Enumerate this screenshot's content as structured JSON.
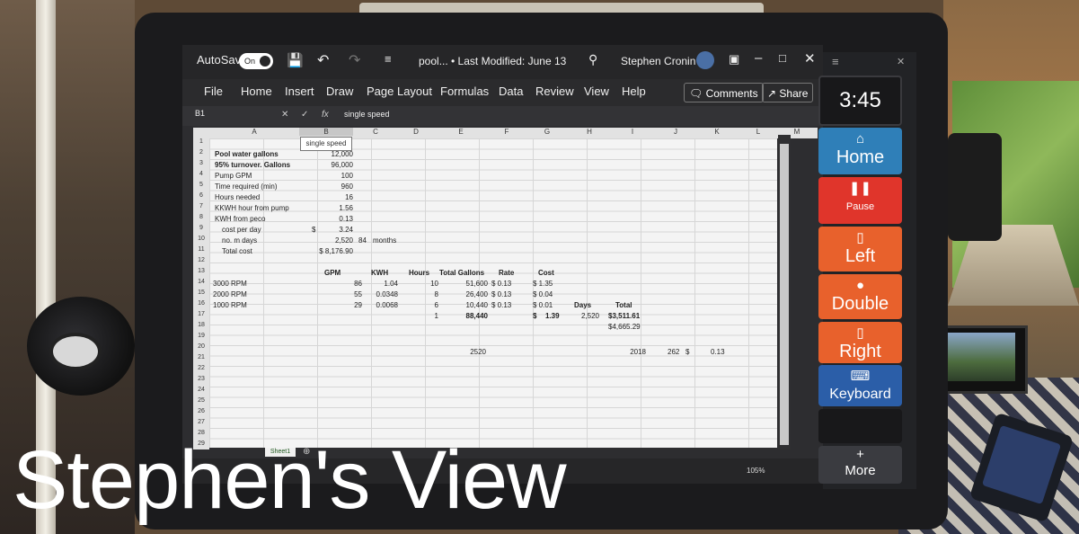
{
  "caption": "Stephen's View",
  "excel": {
    "autosave_label": "AutoSave",
    "autosave_state": "On",
    "filename": "pool... • Last Modified: June 13",
    "user": "Stephen Cronin",
    "menu": [
      "File",
      "Home",
      "Insert",
      "Draw",
      "Page Layout",
      "Formulas",
      "Data",
      "Review",
      "View",
      "Help"
    ],
    "comments_label": "Comments",
    "share_label": "Share",
    "namebox": "B1",
    "formula": "single speed",
    "columns": [
      "A",
      "B",
      "C",
      "D",
      "E",
      "F",
      "G",
      "H",
      "I",
      "J",
      "K",
      "L",
      "M"
    ],
    "rows": [
      "1",
      "2",
      "3",
      "4",
      "5",
      "6",
      "7",
      "8",
      "9",
      "10",
      "11",
      "12",
      "13",
      "14",
      "15",
      "16",
      "17",
      "18",
      "19",
      "20",
      "21",
      "22",
      "23",
      "24",
      "25",
      "26",
      "27",
      "28",
      "29"
    ],
    "tooltip": "single speed",
    "labels": {
      "r2": "Pool water gallons",
      "r3": "95% turnover. Gallons",
      "r4": "Pump GPM",
      "r5": "Time required (min)",
      "r6": "Hours needed",
      "r7": "KKWH hour from pump",
      "r8": "KWH from peco",
      "r9": "cost per day",
      "r10": "no. m days",
      "r11": "Total cost"
    },
    "values": {
      "r2": "12,000",
      "r3": "96,000",
      "r4": "100",
      "r5": "960",
      "r6": "16",
      "r7": "1.56",
      "r8": "0.13",
      "r9_sym": "$",
      "r9": "3.24",
      "r10": "2,520",
      "r10_c": "84",
      "r10_d": "months",
      "r11": "$ 8,176.90"
    },
    "table_headers": [
      "GPM",
      "KWH",
      "Hours",
      "Total Gallons",
      "Rate",
      "Cost"
    ],
    "table_rows": [
      {
        "label": "3000 RPM",
        "gpm": "86",
        "kwh": "1.04",
        "hours": "10",
        "gallons": "51,600",
        "rate": "$ 0.13",
        "cost": "$ 1.35"
      },
      {
        "label": "2000 RPM",
        "gpm": "55",
        "kwh": "0.0348",
        "hours": "8",
        "gallons": "26,400",
        "rate": "$ 0.13",
        "cost": "$ 0.04"
      },
      {
        "label": "1000 RPM",
        "gpm": "29",
        "kwh": "0.0068",
        "hours": "6",
        "gallons": "10,440",
        "rate": "$ 0.13",
        "cost": "$ 0.01"
      }
    ],
    "summary": {
      "hours_total": "1",
      "gallons_total": "88,440",
      "cost_sym": "$",
      "cost_total": "1.39",
      "days_label": "Days",
      "total_label": "Total",
      "days": "2,520",
      "total": "$3,511.61",
      "total2": "$4,665.29",
      "e21": "2520",
      "i21": "2018",
      "j21": "262",
      "k21_sym": "$",
      "k21": "0.13"
    },
    "sheet_tab": "Sheet1",
    "zoom": "105%"
  },
  "panel": {
    "time": "3:45 PM",
    "tiles": [
      {
        "label": "Home",
        "color": "#2f7fb8"
      },
      {
        "label": "Pause",
        "color": "#e0352b"
      },
      {
        "label": "Left",
        "color": "#e8612c"
      },
      {
        "label": "Double",
        "color": "#e8612c"
      },
      {
        "label": "Right",
        "color": "#e8612c"
      },
      {
        "label": "Keyboard",
        "color": "#2b5ea8"
      },
      {
        "label": "More",
        "color": "#3a3b40"
      }
    ]
  }
}
